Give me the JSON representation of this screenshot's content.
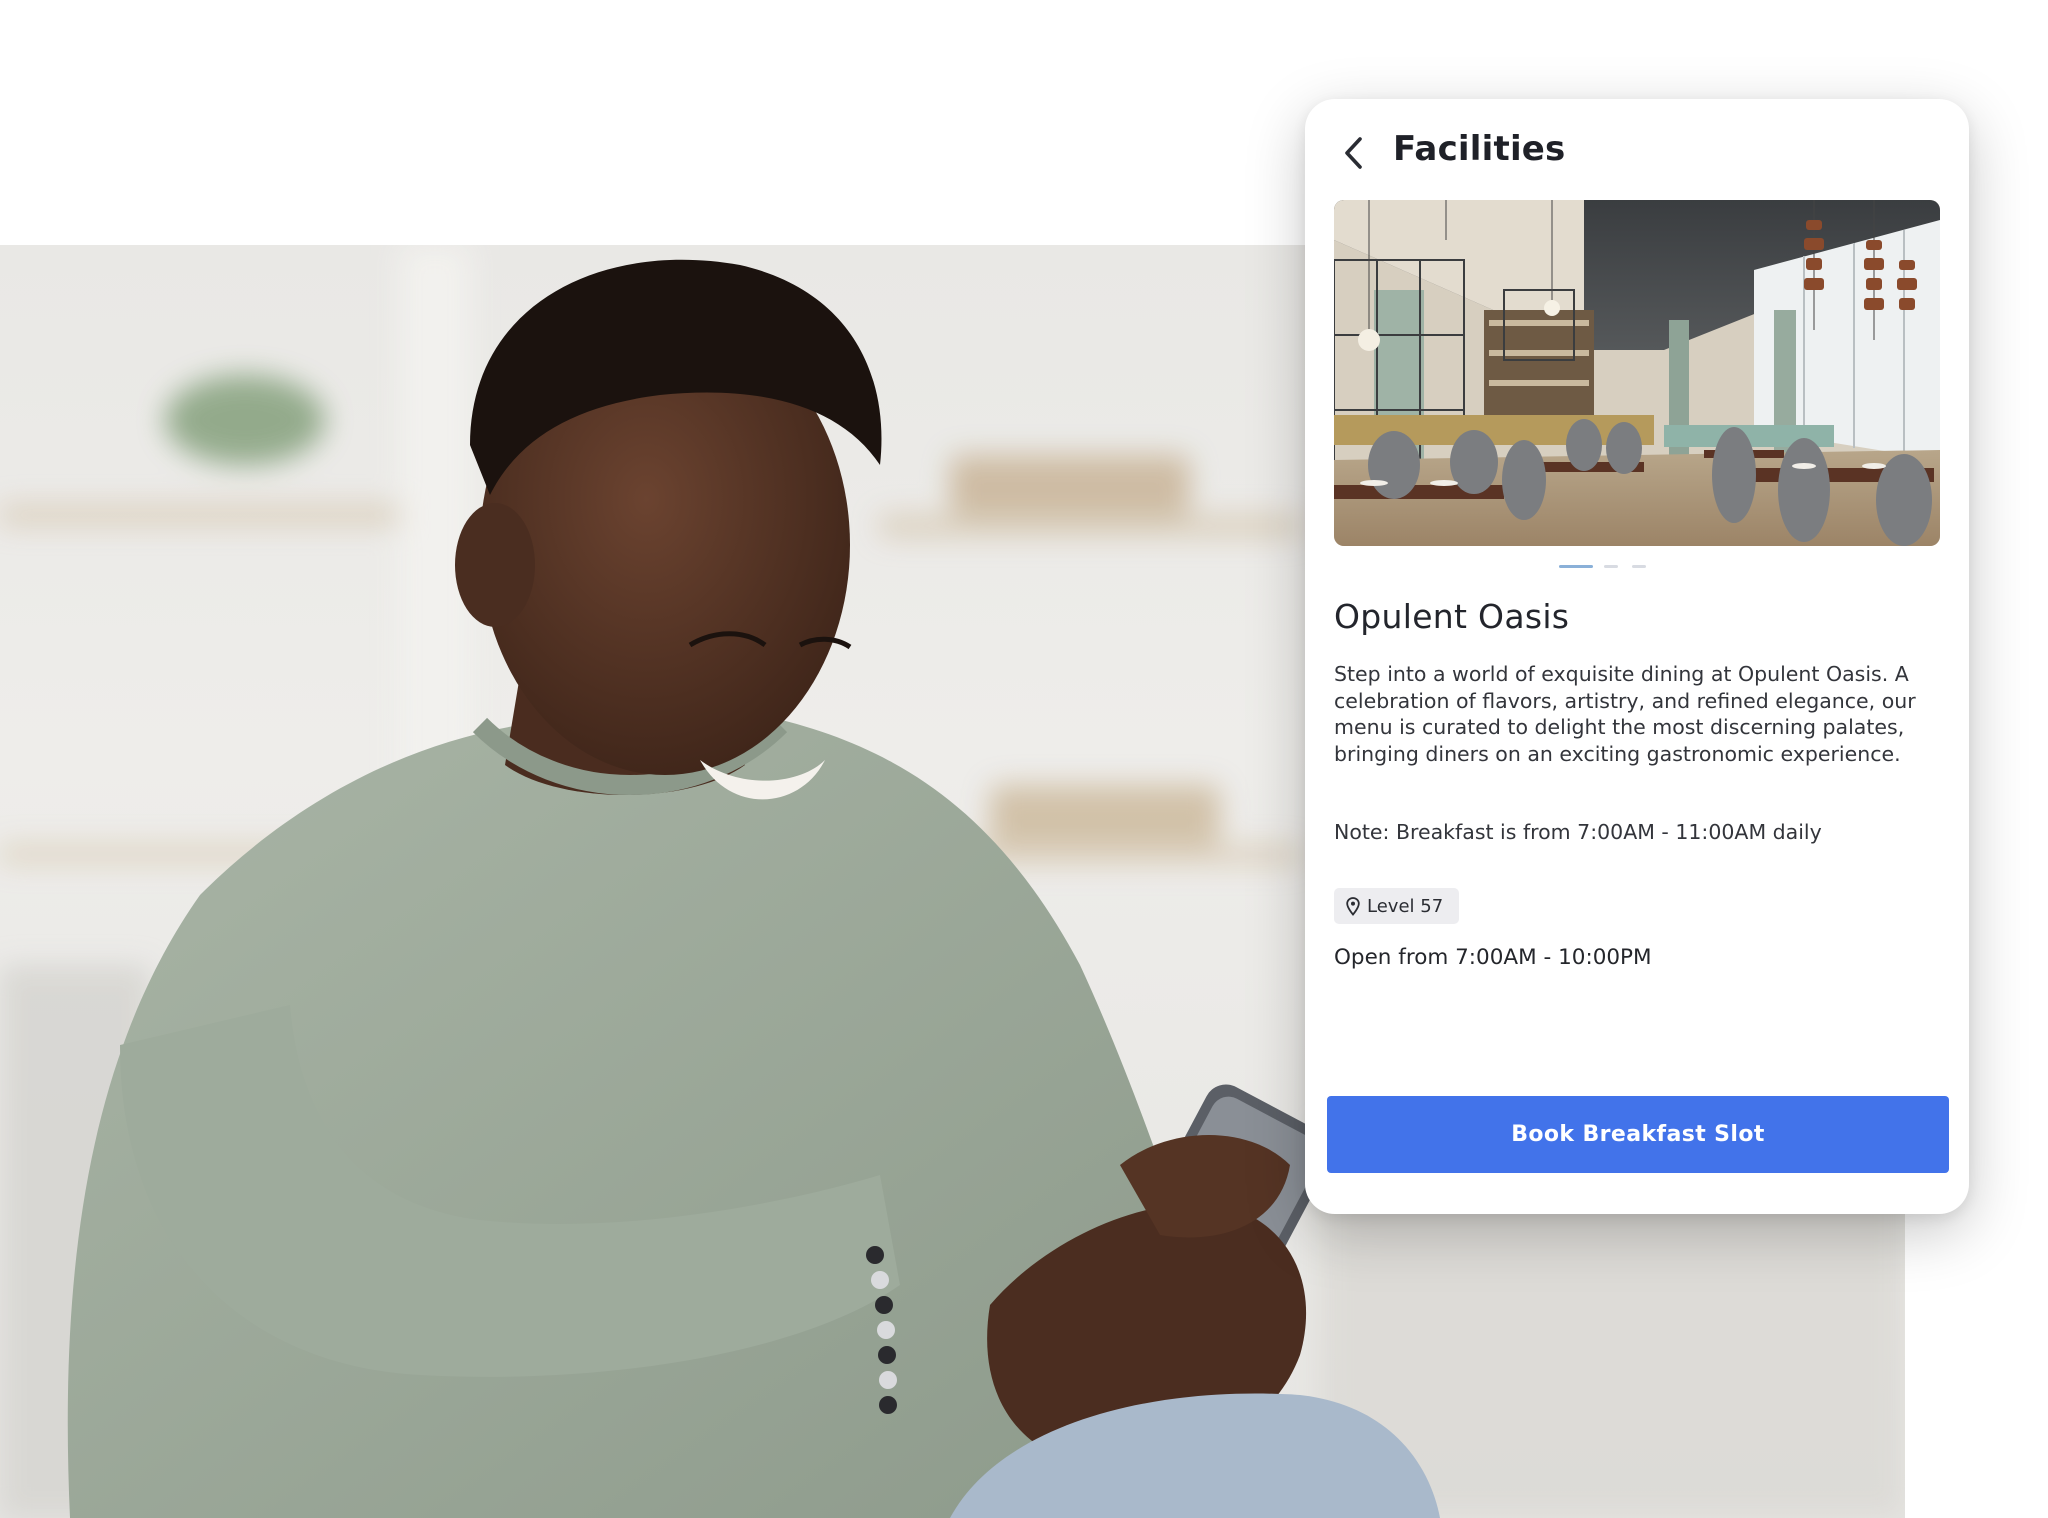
{
  "header": {
    "title": "Facilities",
    "back_icon": "chevron-left-icon"
  },
  "carousel": {
    "image": "restaurant-interior-photo",
    "slide_count": 3,
    "active_slide": 1
  },
  "facility": {
    "name": "Opulent Oasis",
    "description": "Step into a world of exquisite dining at Opulent Oasis. A celebration of flavors, artistry, and refined elegance, our menu is curated to delight the most discerning palates, bringing diners on an exciting gastronomic experience.",
    "note": "Note: Breakfast is from 7:00AM - 11:00AM daily",
    "location_label": "Level 57",
    "location_icon": "map-pin-icon",
    "opening_hours": "Open from 7:00AM - 10:00PM"
  },
  "cta": {
    "label": "Book Breakfast Slot"
  },
  "colors": {
    "primary_button": "#4273ea",
    "card_background": "#ffffff",
    "chip_background": "#ededf0",
    "title_text": "#1f2128"
  }
}
